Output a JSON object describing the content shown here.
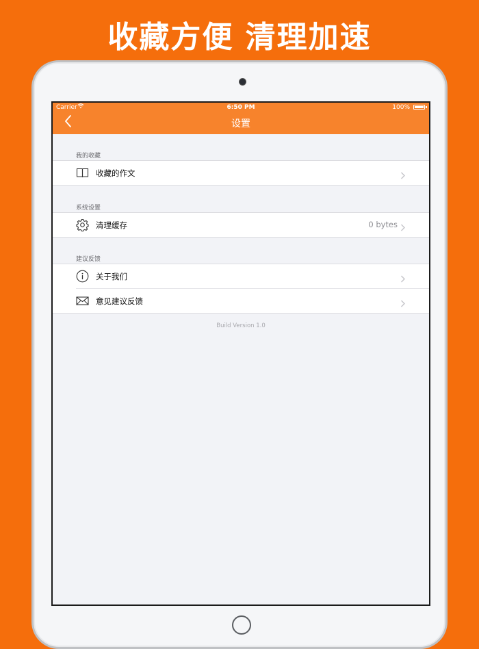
{
  "banner": {
    "headline": "收藏方便 清理加速"
  },
  "status_bar": {
    "carrier": "Carrier",
    "time": "6:50 PM",
    "battery": "100%"
  },
  "navbar": {
    "title": "设置",
    "back_icon": "chevron-left-icon"
  },
  "sections": [
    {
      "header": "我的收藏",
      "rows": [
        {
          "label": "收藏的作文",
          "value": "",
          "icon": "book-icon"
        }
      ]
    },
    {
      "header": "系统设置",
      "rows": [
        {
          "label": "清理缓存",
          "value": "0 bytes",
          "icon": "gear-icon"
        }
      ]
    },
    {
      "header": "建议反馈",
      "rows": [
        {
          "label": "关于我们",
          "value": "",
          "icon": "info-icon"
        },
        {
          "label": "意见建议反馈",
          "value": "",
          "icon": "mail-icon"
        }
      ]
    }
  ],
  "footer": {
    "build_version": "Build Version 1.0"
  },
  "colors": {
    "background": "#f56e0c",
    "navbar": "#f7832c",
    "screen_bg": "#f2f3f7"
  }
}
